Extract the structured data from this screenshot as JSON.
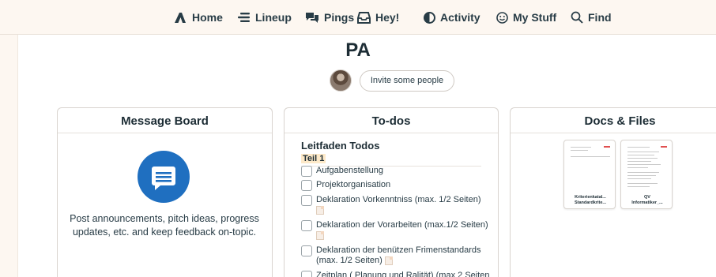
{
  "nav": {
    "items": [
      {
        "label": "Home",
        "icon": "home-icon"
      },
      {
        "label": "Lineup",
        "icon": "lineup-icon"
      },
      {
        "label": "Pings",
        "icon": "pings-icon"
      },
      {
        "label": "Hey!",
        "icon": "hey-icon"
      },
      {
        "label": "Activity",
        "icon": "activity-icon"
      },
      {
        "label": "My Stuff",
        "icon": "my-stuff-icon"
      },
      {
        "label": "Find",
        "icon": "find-icon"
      }
    ]
  },
  "project": {
    "title": "PA",
    "invite_label": "Invite some people"
  },
  "message_board": {
    "title": "Message Board",
    "icon": "message-board-icon",
    "description": "Post announcements, pitch ideas, progress updates, etc. and keep feedback on-topic."
  },
  "todos": {
    "title": "To-dos",
    "list_title": "Leitfaden Todos",
    "group": "Teil 1",
    "items": [
      {
        "label": "Aufgabenstellung",
        "has_note": false
      },
      {
        "label": "Projektorganisation",
        "has_note": false
      },
      {
        "label": "Deklaration Vorkenntniss (max. 1/2 Seiten)",
        "has_note": true
      },
      {
        "label": "Deklaration der Vorarbeiten (max.1/2 Seiten)",
        "has_note": true
      },
      {
        "label": "Deklaration der benützen Frimenstandards (max. 1/2 Seiten)",
        "has_note": true
      },
      {
        "label": "Zeitplan ( Planung und Ralität) (max 2 Seiten",
        "has_note": false
      }
    ]
  },
  "docs": {
    "title": "Docs & Files",
    "files": [
      {
        "line1": "Kriterienkatal...",
        "line2": "Standardkrite..."
      },
      {
        "line1": "QV",
        "line2": "Informatiker_..."
      }
    ]
  },
  "colors": {
    "accent": "#1f6fc0",
    "background": "#fdf7f1",
    "text": "#283c46",
    "highlight": "#fde9c8"
  }
}
